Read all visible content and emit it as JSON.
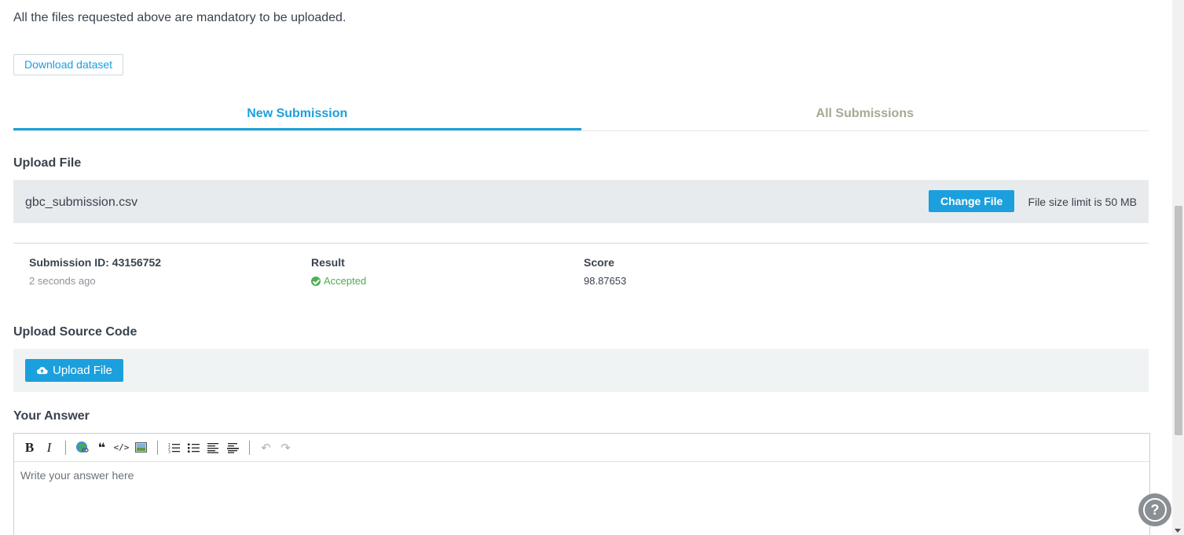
{
  "notice": "All the files requested above are mandatory to be uploaded.",
  "download_label": "Download dataset",
  "tabs": [
    {
      "label": "New Submission",
      "active": true
    },
    {
      "label": "All Submissions",
      "active": false
    }
  ],
  "upload_file": {
    "title": "Upload File",
    "file_name": "gbc_submission.csv",
    "change_label": "Change File",
    "size_limit": "File size limit is 50 MB"
  },
  "submission": {
    "id_label": "Submission ID: 43156752",
    "time": "2 seconds ago",
    "result_label": "Result",
    "result_value": "Accepted",
    "score_label": "Score",
    "score_value": "98.87653"
  },
  "source_code": {
    "title": "Upload Source Code",
    "upload_label": "Upload File"
  },
  "answer": {
    "title": "Your Answer",
    "placeholder": "Write your answer here"
  },
  "toolbar": {
    "bold": "B",
    "italic": "I",
    "quote": "❝",
    "code": "</>",
    "undo": "↶",
    "redo": "↷"
  },
  "help_icon": "?",
  "colors": {
    "accent": "#1ba0dd",
    "success": "#4caf50",
    "inactive_tab": "#a8a895"
  }
}
